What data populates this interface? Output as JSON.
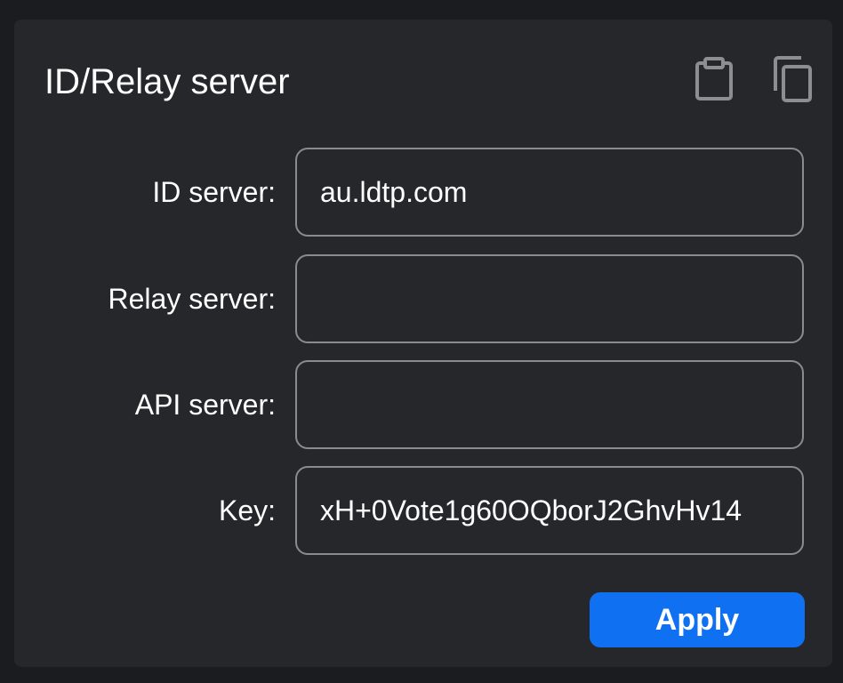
{
  "section": {
    "title": "ID/Relay server",
    "icons": {
      "paste": "clipboard-paste-icon",
      "copy": "copy-icon"
    }
  },
  "form": {
    "id_server": {
      "label": "ID server:",
      "value": "au.ldtp.com"
    },
    "relay_server": {
      "label": "Relay server:",
      "value": ""
    },
    "api_server": {
      "label": "API server:",
      "value": ""
    },
    "key": {
      "label": "Key:",
      "value": "xH+0Vote1g60OQborJ2GhvHv14"
    }
  },
  "actions": {
    "apply_label": "Apply"
  },
  "colors": {
    "background": "#1b1c20",
    "panel": "#26272b",
    "input_border": "#8a8b8f",
    "accent": "#0f71f2",
    "text": "#ffffff"
  }
}
